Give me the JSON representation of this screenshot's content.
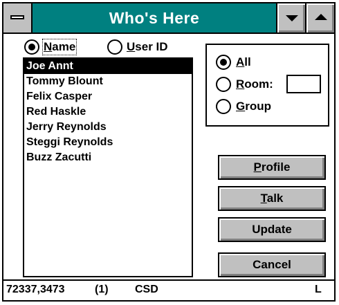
{
  "window": {
    "title": "Who's Here"
  },
  "titlebar": {
    "system_menu_icon": "system-menu-icon",
    "minimize_icon": "minimize-arrow-icon",
    "maximize_icon": "maximize-arrow-icon"
  },
  "sort": {
    "name": {
      "mnemonic": "N",
      "rest": "ame",
      "selected": true
    },
    "user_id": {
      "mnemonic": "U",
      "rest": "ser ID",
      "selected": false
    }
  },
  "users": [
    "Joe Annt",
    "Tommy Blount",
    "Felix Casper",
    "Red Haskle",
    "Jerry Reynolds",
    "Steggi Reynolds",
    "Buzz Zacutti"
  ],
  "selected_user_index": 0,
  "scope": {
    "all": {
      "mnemonic": "A",
      "rest": "ll",
      "selected": true
    },
    "room": {
      "mnemonic": "R",
      "rest": "oom:",
      "value": "",
      "selected": false
    },
    "group": {
      "mnemonic": "G",
      "rest": "roup",
      "selected": false
    }
  },
  "buttons": {
    "profile": {
      "mnemonic": "P",
      "rest": "rofile"
    },
    "talk": {
      "mnemonic": "T",
      "rest": "alk"
    },
    "update": {
      "label": "Update"
    },
    "cancel": {
      "label": "Cancel"
    }
  },
  "status": {
    "user_number": "72337,3473",
    "count": "(1)",
    "service": "CSD",
    "flag": "L"
  }
}
